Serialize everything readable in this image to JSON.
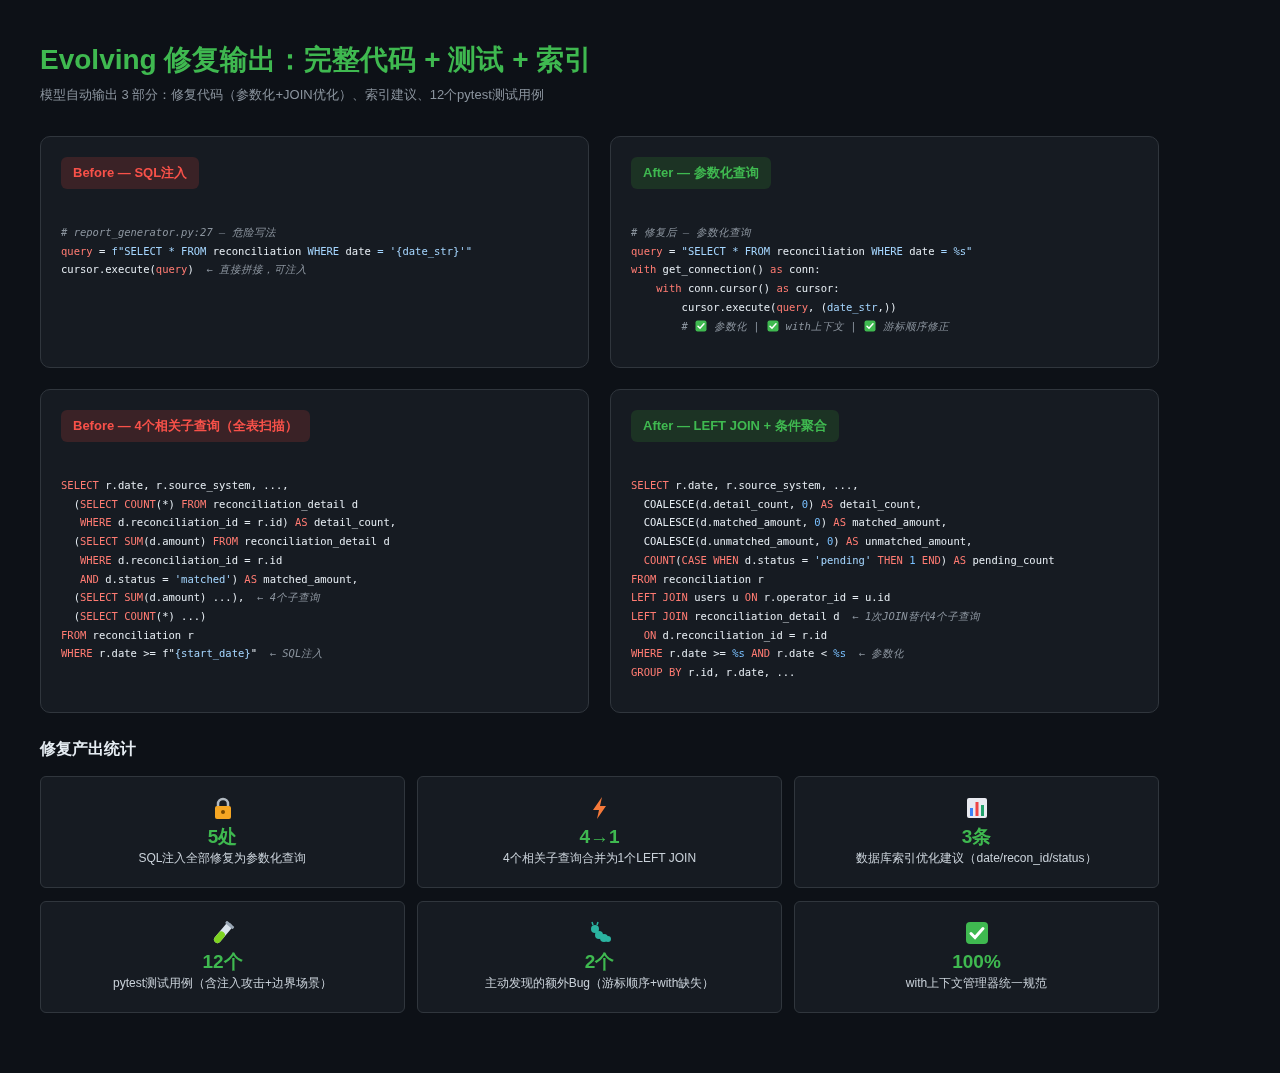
{
  "title": "Evolving 修复输出：完整代码 + 测试 + 索引",
  "subtitle": "模型自动输出 3 部分：修复代码（参数化+JOIN优化）、索引建议、12个pytest测试用例",
  "panels": [
    {
      "badge": "Before — SQL注入",
      "kind": "before",
      "lines": [
        [
          {
            "t": "# report_generator.py:27 — 危险写法",
            "kind": "cm"
          }
        ],
        [
          {
            "t": "query",
            "kind": "kw"
          },
          {
            "t": " = ",
            "kind": "plain"
          },
          {
            "t": "f\"SELECT * FROM ",
            "kind": "str"
          },
          {
            "t": "reconciliation",
            "kind": "plain"
          },
          {
            "t": " WHERE ",
            "kind": "str"
          },
          {
            "t": "date",
            "kind": "plain"
          },
          {
            "t": " = '{date_str}'\"",
            "kind": "str"
          }
        ],
        [
          {
            "t": "cursor.execute(",
            "kind": "plain"
          },
          {
            "t": "query",
            "kind": "kw"
          },
          {
            "t": ")",
            "kind": "plain"
          },
          {
            "t": "  ← 直接拼接，可注入",
            "kind": "cm"
          }
        ]
      ]
    },
    {
      "badge": "After — 参数化查询",
      "kind": "after",
      "lines": [
        [
          {
            "t": "# 修复后 — 参数化查询",
            "kind": "cm"
          }
        ],
        [
          {
            "t": "query",
            "kind": "kw"
          },
          {
            "t": " = ",
            "kind": "plain"
          },
          {
            "t": "\"SELECT * FROM ",
            "kind": "str"
          },
          {
            "t": "reconciliation",
            "kind": "plain"
          },
          {
            "t": " WHERE ",
            "kind": "str"
          },
          {
            "t": "date",
            "kind": "plain"
          },
          {
            "t": " = %s\"",
            "kind": "str"
          }
        ],
        [
          {
            "t": "with",
            "kind": "kw"
          },
          {
            "t": " get_connection() ",
            "kind": "plain"
          },
          {
            "t": "as",
            "kind": "kw"
          },
          {
            "t": " conn:",
            "kind": "plain"
          }
        ],
        [
          {
            "t": "    with",
            "kind": "kw"
          },
          {
            "t": " conn.cursor() ",
            "kind": "plain"
          },
          {
            "t": "as",
            "kind": "kw"
          },
          {
            "t": " cursor:",
            "kind": "plain"
          }
        ],
        [
          {
            "t": "        cursor.execute(",
            "kind": "plain"
          },
          {
            "t": "query",
            "kind": "kw"
          },
          {
            "t": ", (",
            "kind": "plain"
          },
          {
            "t": "date_str",
            "kind": "str"
          },
          {
            "t": ",))",
            "kind": "plain"
          }
        ],
        [
          {
            "t": "        #",
            "kind": "cm"
          },
          {
            "kind": "check"
          },
          {
            "t": "参数化 |",
            "kind": "cm"
          },
          {
            "kind": "check"
          },
          {
            "t": "with上下文 |",
            "kind": "cm"
          },
          {
            "kind": "check"
          },
          {
            "t": "游标顺序修正",
            "kind": "cm"
          }
        ]
      ]
    },
    {
      "badge": "Before — 4个相关子查询（全表扫描）",
      "kind": "before",
      "lines": [
        [
          {
            "t": "SELECT",
            "kind": "kw"
          },
          {
            "t": " r.date, r.source_system, ...,",
            "kind": "plain"
          }
        ],
        [
          {
            "t": "  (",
            "kind": "plain"
          },
          {
            "t": "SELECT COUNT",
            "kind": "kw"
          },
          {
            "t": "(*) ",
            "kind": "plain"
          },
          {
            "t": "FROM",
            "kind": "kw"
          },
          {
            "t": " reconciliation_detail d",
            "kind": "plain"
          }
        ],
        [
          {
            "t": "   WHERE",
            "kind": "kw"
          },
          {
            "t": " d.reconciliation_id = r.id) ",
            "kind": "plain"
          },
          {
            "t": "AS",
            "kind": "kw"
          },
          {
            "t": " detail_count,",
            "kind": "plain"
          }
        ],
        [
          {
            "t": "  (",
            "kind": "plain"
          },
          {
            "t": "SELECT SUM",
            "kind": "kw"
          },
          {
            "t": "(d.amount) ",
            "kind": "plain"
          },
          {
            "t": "FROM",
            "kind": "kw"
          },
          {
            "t": " reconciliation_detail d",
            "kind": "plain"
          }
        ],
        [
          {
            "t": "   WHERE",
            "kind": "kw"
          },
          {
            "t": " d.reconciliation_id = r.id",
            "kind": "plain"
          }
        ],
        [
          {
            "t": "   AND",
            "kind": "kw"
          },
          {
            "t": " d.status = ",
            "kind": "plain"
          },
          {
            "t": "'matched'",
            "kind": "str"
          },
          {
            "t": ") ",
            "kind": "plain"
          },
          {
            "t": "AS",
            "kind": "kw"
          },
          {
            "t": " matched_amount,",
            "kind": "plain"
          }
        ],
        [
          {
            "t": "  (",
            "kind": "plain"
          },
          {
            "t": "SELECT SUM",
            "kind": "kw"
          },
          {
            "t": "(d.amount) ...),",
            "kind": "plain"
          },
          {
            "t": "  ← 4个子查询",
            "kind": "cm"
          }
        ],
        [
          {
            "t": "  (",
            "kind": "plain"
          },
          {
            "t": "SELECT COUNT",
            "kind": "kw"
          },
          {
            "t": "(*) ...)",
            "kind": "plain"
          }
        ],
        [
          {
            "t": "FROM",
            "kind": "kw"
          },
          {
            "t": " reconciliation r",
            "kind": "plain"
          }
        ],
        [
          {
            "t": "WHERE",
            "kind": "kw"
          },
          {
            "t": " r.date >= f\"",
            "kind": "plain"
          },
          {
            "t": "{start_date}",
            "kind": "str"
          },
          {
            "t": "\"",
            "kind": "plain"
          },
          {
            "t": "  ← SQL注入",
            "kind": "cm"
          }
        ]
      ]
    },
    {
      "badge": "After — LEFT JOIN + 条件聚合",
      "kind": "after",
      "lines": [
        [
          {
            "t": "SELECT",
            "kind": "kw"
          },
          {
            "t": " r.date, r.source_system, ...,",
            "kind": "plain"
          }
        ],
        [
          {
            "t": "  COALESCE(d.detail_count, ",
            "kind": "plain"
          },
          {
            "t": "0",
            "kind": "num"
          },
          {
            "t": ") ",
            "kind": "plain"
          },
          {
            "t": "AS",
            "kind": "kw"
          },
          {
            "t": " detail_count,",
            "kind": "plain"
          }
        ],
        [
          {
            "t": "  COALESCE(d.matched_amount, ",
            "kind": "plain"
          },
          {
            "t": "0",
            "kind": "num"
          },
          {
            "t": ") ",
            "kind": "plain"
          },
          {
            "t": "AS",
            "kind": "kw"
          },
          {
            "t": " matched_amount,",
            "kind": "plain"
          }
        ],
        [
          {
            "t": "  COALESCE(d.unmatched_amount, ",
            "kind": "plain"
          },
          {
            "t": "0",
            "kind": "num"
          },
          {
            "t": ") ",
            "kind": "plain"
          },
          {
            "t": "AS",
            "kind": "kw"
          },
          {
            "t": " unmatched_amount,",
            "kind": "plain"
          }
        ],
        [
          {
            "t": "  COUNT",
            "kind": "kw"
          },
          {
            "t": "(",
            "kind": "plain"
          },
          {
            "t": "CASE WHEN",
            "kind": "kw"
          },
          {
            "t": " d.status = ",
            "kind": "plain"
          },
          {
            "t": "'pending'",
            "kind": "str"
          },
          {
            "t": " THEN ",
            "kind": "kw"
          },
          {
            "t": "1",
            "kind": "num"
          },
          {
            "t": " END",
            "kind": "kw"
          },
          {
            "t": ") ",
            "kind": "plain"
          },
          {
            "t": "AS",
            "kind": "kw"
          },
          {
            "t": " pending_count",
            "kind": "plain"
          }
        ],
        [
          {
            "t": "FROM",
            "kind": "kw"
          },
          {
            "t": " reconciliation r",
            "kind": "plain"
          }
        ],
        [
          {
            "t": "LEFT JOIN",
            "kind": "kw"
          },
          {
            "t": " users u ",
            "kind": "plain"
          },
          {
            "t": "ON",
            "kind": "kw"
          },
          {
            "t": " r.operator_id = u.id",
            "kind": "plain"
          }
        ],
        [
          {
            "t": "LEFT JOIN",
            "kind": "kw"
          },
          {
            "t": " reconciliation_detail d",
            "kind": "plain"
          },
          {
            "t": "  ← 1次JOIN替代4个子查询",
            "kind": "cm"
          }
        ],
        [
          {
            "t": "  ON",
            "kind": "kw"
          },
          {
            "t": " d.reconciliation_id = r.id",
            "kind": "plain"
          }
        ],
        [
          {
            "t": "WHERE",
            "kind": "kw"
          },
          {
            "t": " r.date >= ",
            "kind": "plain"
          },
          {
            "t": "%s",
            "kind": "num"
          },
          {
            "t": " AND",
            "kind": "kw"
          },
          {
            "t": " r.date < ",
            "kind": "plain"
          },
          {
            "t": "%s",
            "kind": "num"
          },
          {
            "t": "  ← 参数化",
            "kind": "cm"
          }
        ],
        [
          {
            "t": "GROUP BY",
            "kind": "kw"
          },
          {
            "t": " r.id, r.date, ...",
            "kind": "plain"
          }
        ]
      ]
    }
  ],
  "stats_heading": "修复产出统计",
  "stats": [
    {
      "kind": "lock",
      "value": "5处",
      "caption": "SQL注入全部修复为参数化查询"
    },
    {
      "kind": "bolt",
      "value": "4→1",
      "caption": "4个相关子查询合并为1个LEFT JOIN"
    },
    {
      "kind": "chart",
      "value": "3条",
      "caption": "数据库索引优化建议（date/recon_id/status）"
    },
    {
      "kind": "tube",
      "value": "12个",
      "caption": "pytest测试用例（含注入攻击+边界场景）"
    },
    {
      "kind": "bug",
      "value": "2个",
      "caption": "主动发现的额外Bug（游标顺序+with缺失）"
    },
    {
      "kind": "check",
      "value": "100%",
      "caption": "with上下文管理器统一规范"
    }
  ]
}
